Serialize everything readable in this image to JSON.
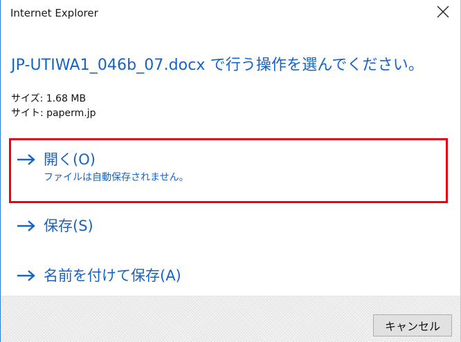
{
  "window": {
    "title": "Internet Explorer"
  },
  "prompt": {
    "heading": "JP-UTIWA1_046b_07.docx で行う操作を選んでください。",
    "size_text": "サイズ: 1.68 MB",
    "site_text": "サイト: paperm.jp"
  },
  "options": [
    {
      "title": "開く(O)",
      "subtitle": "ファイルは自動保存されません。",
      "icon": "arrow-right-icon"
    },
    {
      "title": "保存(S)",
      "icon": "arrow-right-icon"
    },
    {
      "title": "名前を付けて保存(A)",
      "icon": "arrow-right-icon"
    }
  ],
  "footer": {
    "cancel_label": "キャンセル"
  },
  "colors": {
    "accent": "#1463c8",
    "highlight_border": "#e30613",
    "window_border": "#2b79d8"
  }
}
